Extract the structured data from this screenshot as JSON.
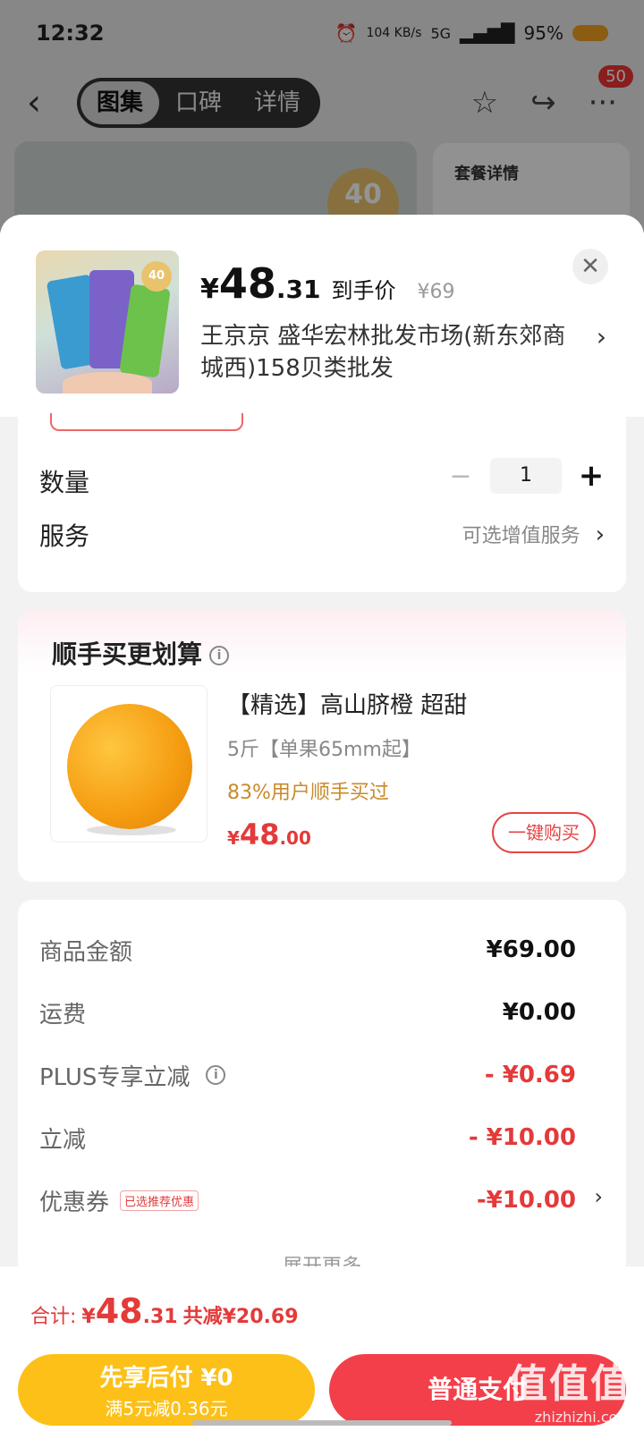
{
  "status_bar": {
    "time": "12:32",
    "net_speed": "104 KB/s",
    "signal": "5G",
    "battery": "95%"
  },
  "top_nav": {
    "tabs": [
      {
        "label": "图集"
      },
      {
        "label": "口碑"
      },
      {
        "label": "详情"
      }
    ],
    "message_badge": "50"
  },
  "background": {
    "hero_qty": "40",
    "package_title": "套餐详情"
  },
  "sheet": {
    "price": {
      "yen": "¥",
      "int": "48",
      "dec": ".31",
      "label": "到手价",
      "original": "¥69"
    },
    "thumb_tag": "40",
    "shop": "王京京  盛华宏林批发市场(新东郊商城西)158贝类批发",
    "quantity": {
      "label": "数量",
      "value": "1"
    },
    "service": {
      "label": "服务",
      "value": "可选增值服务"
    }
  },
  "addon": {
    "title": "顺手买更划算",
    "product": {
      "name": "【精选】高山脐橙 超甜",
      "spec": "5斤【单果65mm起】",
      "social": "83%用户顺手买过",
      "price_yen": "¥",
      "price_int": "48",
      "price_dec": ".00",
      "buy_label": "一键购买"
    }
  },
  "summary": {
    "rows": [
      {
        "label": "商品金额",
        "value": "¥69.00"
      },
      {
        "label": "运费",
        "value": "¥0.00"
      },
      {
        "label": "PLUS专享立减",
        "value": "- ¥0.69"
      },
      {
        "label": "立减",
        "value": "- ¥10.00"
      },
      {
        "label": "优惠券",
        "value": "-¥10.00",
        "tag": "已选推荐优惠"
      }
    ],
    "expand": "展开更多"
  },
  "footer": {
    "total_label": "合计:",
    "total_yen": "¥",
    "total_int": "48",
    "total_dec": ".31",
    "total_save": "共减¥20.69",
    "credit_main": "先享后付 ¥0",
    "credit_sub": "满5元减0.36元",
    "pay_label": "普通支付",
    "watermark": "值值值",
    "watermark_url": "zhizhizhi.com"
  },
  "colors": {
    "accent": "#e43a3a",
    "credit": "#fcc018",
    "pay": "#f23f4a"
  }
}
